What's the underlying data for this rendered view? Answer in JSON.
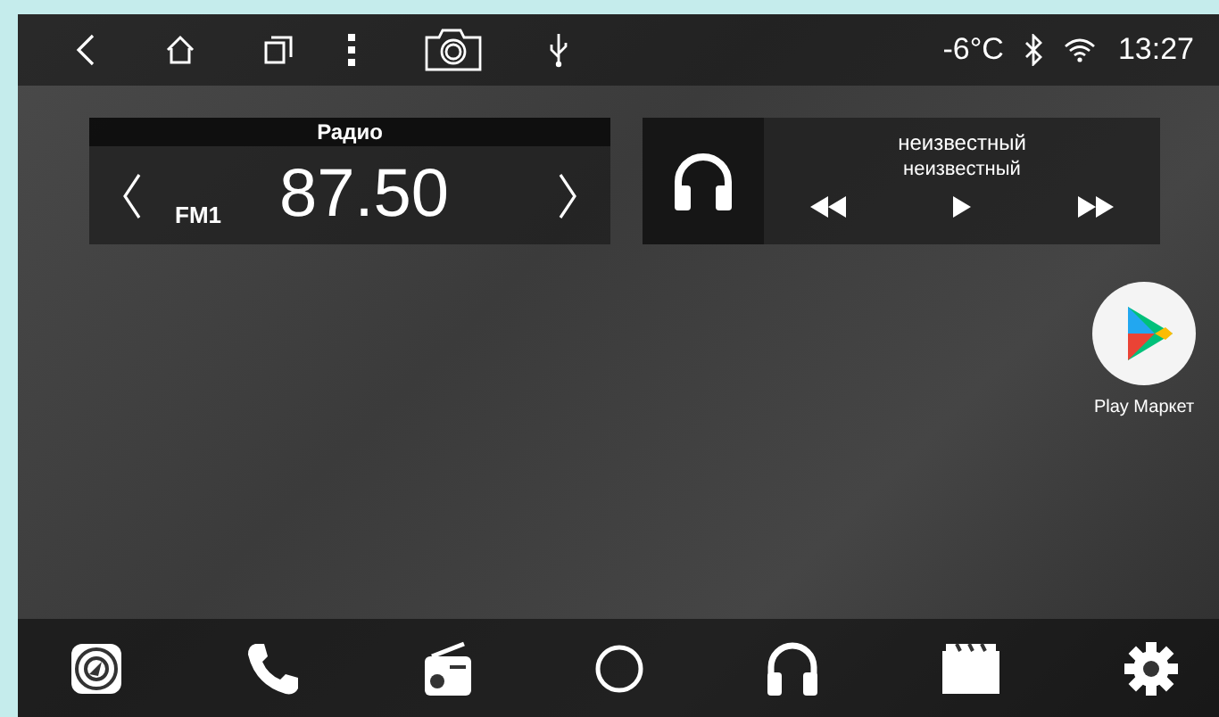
{
  "status_bar": {
    "temperature": "-6°C",
    "time": "13:27"
  },
  "radio_widget": {
    "title": "Радио",
    "band": "FM1",
    "frequency": "87.50"
  },
  "media_widget": {
    "title": "неизвестный",
    "artist": "неизвестный"
  },
  "apps": [
    {
      "label": "Play Маркет"
    }
  ]
}
